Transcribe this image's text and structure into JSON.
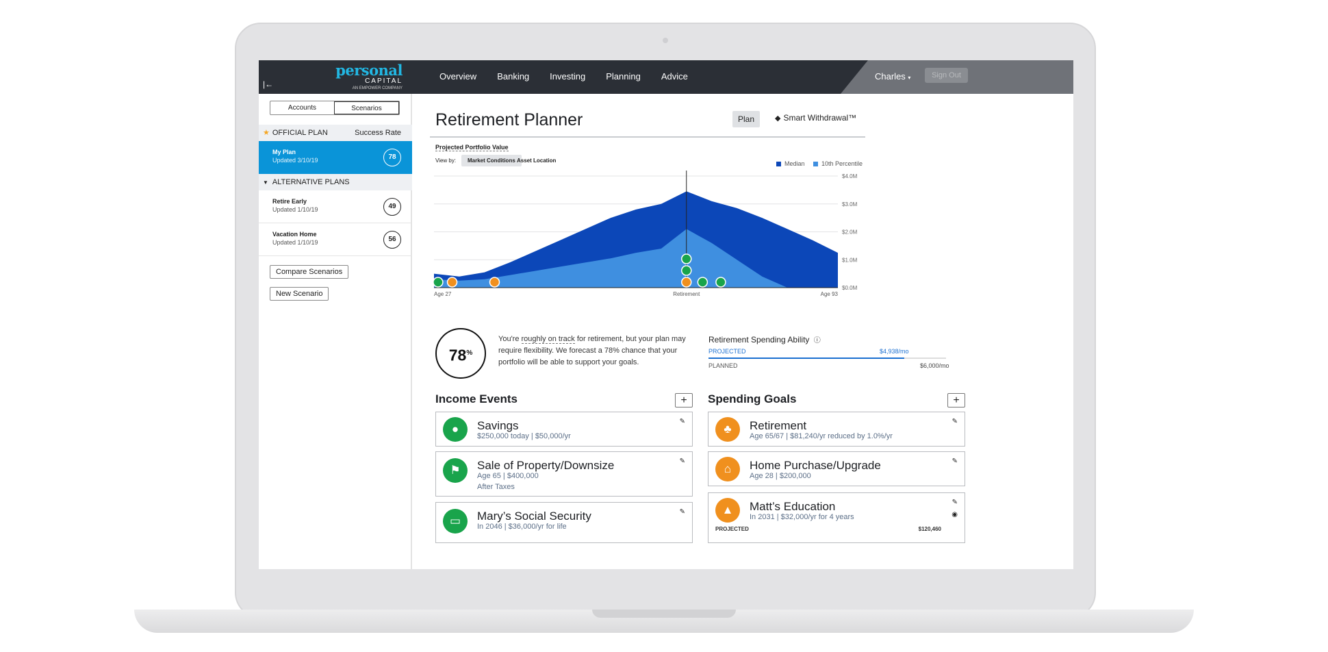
{
  "app": {
    "logo_main": "personal",
    "logo_cap": "CAPITAL",
    "logo_sub": "AN EMPOWER COMPANY"
  },
  "nav": {
    "items": [
      "Overview",
      "Banking",
      "Investing",
      "Planning",
      "Advice"
    ],
    "user": "Charles",
    "signout": "Sign Out"
  },
  "sidebar": {
    "toggle": [
      "Accounts",
      "Scenarios"
    ],
    "official_header": "OFFICIAL PLAN",
    "success_rate": "Success Rate",
    "official_plan": {
      "name": "My Plan",
      "date": "Updated 3/10/19",
      "score": "78"
    },
    "alternative_header": "ALTERNATIVE PLANS",
    "alternatives": [
      {
        "name": "Retire Early",
        "date": "Updated 1/10/19",
        "score": "49"
      },
      {
        "name": "Vacation Home",
        "date": "Updated 1/10/19",
        "score": "56"
      }
    ],
    "compare_btn": "Compare Scenarios",
    "new_btn": "New Scenario"
  },
  "main": {
    "title": "Retirement Planner",
    "plan_btn": "Plan",
    "smart_btn": "Smart Withdrawal™",
    "ppv_label": "Projected Portfolio Value",
    "view_by": "View by:",
    "view_options": [
      "Market Conditions",
      "Asset Location"
    ],
    "legend": [
      {
        "name": "Median",
        "color": "#0c47b8"
      },
      {
        "name": "10th Percentile",
        "color": "#3f8fe0"
      }
    ]
  },
  "chart_data": {
    "type": "area",
    "x_labels": [
      "Age 27",
      "Retirement",
      "Age 93"
    ],
    "y_ticks": [
      "$0.0M",
      "$1.0M",
      "$2.0M",
      "$3.0M",
      "$4.0M"
    ],
    "ylim": [
      0,
      4.0
    ],
    "series": [
      {
        "name": "Median",
        "color": "#0c47b8",
        "values": [
          0.5,
          0.4,
          0.55,
          0.9,
          1.3,
          1.7,
          2.1,
          2.5,
          2.8,
          3.0,
          3.45,
          3.1,
          2.85,
          2.5,
          2.1,
          1.7,
          1.25
        ]
      },
      {
        "name": "10th Percentile",
        "color": "#3f8fe0",
        "values": [
          0.3,
          0.25,
          0.3,
          0.45,
          0.6,
          0.75,
          0.9,
          1.05,
          1.25,
          1.4,
          2.1,
          1.6,
          1.0,
          0.4,
          0.0,
          0.0,
          0.0
        ]
      }
    ],
    "markers": [
      {
        "pos": 0.01,
        "color": "#19a44b",
        "icon": "piggy-bank-icon"
      },
      {
        "pos": 0.045,
        "color": "#f0901e",
        "icon": "house-icon"
      },
      {
        "pos": 0.15,
        "color": "#f0901e",
        "icon": "graduation-cap-icon"
      },
      {
        "pos": 0.625,
        "color": "#f0901e",
        "icon": "palm-tree-icon"
      },
      {
        "pos": 0.665,
        "color": "#19a44b",
        "icon": "money-icon"
      },
      {
        "pos": 0.71,
        "color": "#19a44b",
        "icon": "money-icon"
      }
    ],
    "stacked_markers": [
      {
        "color": "#19a44b",
        "icon": "flag-sign-icon"
      },
      {
        "color": "#19a44b",
        "icon": "money-icon"
      }
    ],
    "retirement_marker_pos": 0.625,
    "grid": true
  },
  "summary": {
    "score": "78",
    "score_unit": "%",
    "text_pre": "You're ",
    "text_link": "roughly on track",
    "text_post": " for retirement, but your plan may require flexibility. We forecast a 78% chance that your portfolio will be able to support your goals."
  },
  "rsa": {
    "title": "Retirement Spending Ability",
    "projected_label": "PROJECTED",
    "projected_value": "$4,938/mo",
    "projected_fraction": 0.823,
    "planned_label": "PLANNED",
    "planned_value": "$6,000/mo"
  },
  "income": {
    "title": "Income Events",
    "add": "+",
    "cards": [
      {
        "title": "Savings",
        "sub": "$250,000 today | $50,000/yr",
        "sub2": ""
      },
      {
        "title": "Sale of Property/Downsize",
        "sub": "Age 65 | $400,000",
        "sub2": "After Taxes"
      },
      {
        "title": "Mary’s Social Security",
        "sub": "In 2046 | $36,000/yr for life",
        "sub2": ""
      }
    ]
  },
  "spending": {
    "title": "Spending Goals",
    "add": "+",
    "cards": [
      {
        "title": "Retirement",
        "sub": "Age 65/67 | $81,240/yr reduced by 1.0%/yr"
      },
      {
        "title": "Home Purchase/Upgrade",
        "sub": "Age 28 | $200,000"
      },
      {
        "title": "Matt’s Education",
        "sub": "In 2031 | $32,000/yr for 4 years",
        "proj_label": "PROJECTED",
        "proj_value": "$120,460"
      }
    ]
  }
}
